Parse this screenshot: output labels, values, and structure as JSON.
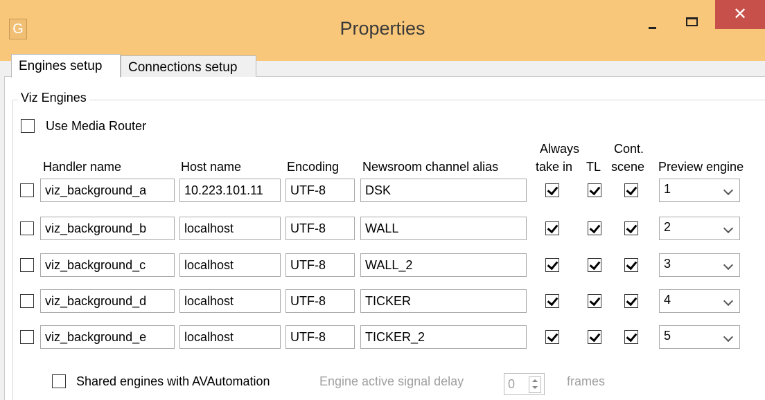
{
  "window": {
    "app_icon": "G",
    "title": "Properties",
    "close_glyph": "✕"
  },
  "tabs": [
    {
      "label": "Engines setup",
      "active": true
    },
    {
      "label": "Connections setup",
      "active": false
    }
  ],
  "group": {
    "label": "Viz Engines",
    "use_media_router": {
      "label": "Use Media Router",
      "checked": false
    }
  },
  "columns": {
    "handler_name": "Handler name",
    "host_name": "Host name",
    "encoding": "Encoding",
    "alias": "Newsroom channel alias",
    "always_take_in_1": "Always",
    "always_take_in_2": "take in",
    "tl": "TL",
    "cont_scene_1": "Cont.",
    "cont_scene_2": "scene",
    "preview_engine": "Preview engine"
  },
  "rows": [
    {
      "selected": false,
      "handler": "viz_background_a",
      "host": "10.223.101.11",
      "encoding": "UTF-8",
      "alias": "DSK",
      "always_take_in": true,
      "tl": true,
      "cont_scene": true,
      "preview": "1"
    },
    {
      "selected": false,
      "handler": "viz_background_b",
      "host": "localhost",
      "encoding": "UTF-8",
      "alias": "WALL",
      "always_take_in": true,
      "tl": true,
      "cont_scene": true,
      "preview": "2"
    },
    {
      "selected": false,
      "handler": "viz_background_c",
      "host": "localhost",
      "encoding": "UTF-8",
      "alias": "WALL_2",
      "always_take_in": true,
      "tl": true,
      "cont_scene": true,
      "preview": "3"
    },
    {
      "selected": false,
      "handler": "viz_background_d",
      "host": "localhost",
      "encoding": "UTF-8",
      "alias": "TICKER",
      "always_take_in": true,
      "tl": true,
      "cont_scene": true,
      "preview": "4"
    },
    {
      "selected": false,
      "handler": "viz_background_e",
      "host": "localhost",
      "encoding": "UTF-8",
      "alias": "TICKER_2",
      "always_take_in": true,
      "tl": true,
      "cont_scene": true,
      "preview": "5"
    }
  ],
  "footer": {
    "shared_engines": {
      "label": "Shared engines with AVAutomation",
      "checked": false
    },
    "delay_label": "Engine active signal delay",
    "delay_value": "0",
    "frames_label": "frames"
  }
}
